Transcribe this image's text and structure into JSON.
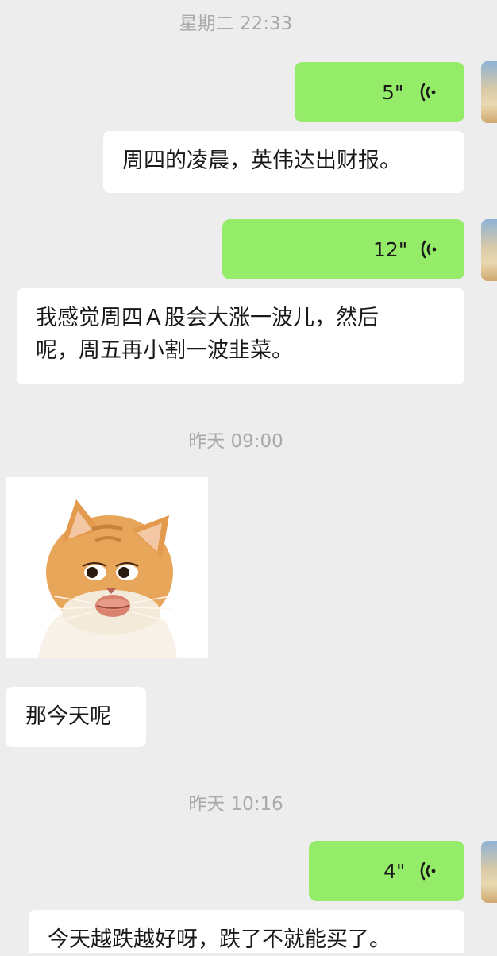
{
  "timestamps": {
    "t1": "星期二 22:33",
    "t2": "昨天 09:00",
    "t3": "昨天 10:16"
  },
  "messages": {
    "voice1": {
      "duration": "5\"",
      "transcript": "周四的凌晨，英伟达出财报。"
    },
    "voice2": {
      "duration": "12\"",
      "transcript": "我感觉周四Ａ股会大涨一波儿，然后\n呢，周五再小割一波韭菜。"
    },
    "sticker": {
      "icon": "cat-sticker"
    },
    "text1": {
      "text": "那今天呢"
    },
    "voice3": {
      "duration": "4\"",
      "transcript": "今天越跌越好呀，跌了不就能买了。"
    }
  },
  "colors": {
    "background": "#ededed",
    "sent_bubble": "#95ec69",
    "received_bubble": "#ffffff",
    "timestamp_text": "#a9a9a9"
  }
}
